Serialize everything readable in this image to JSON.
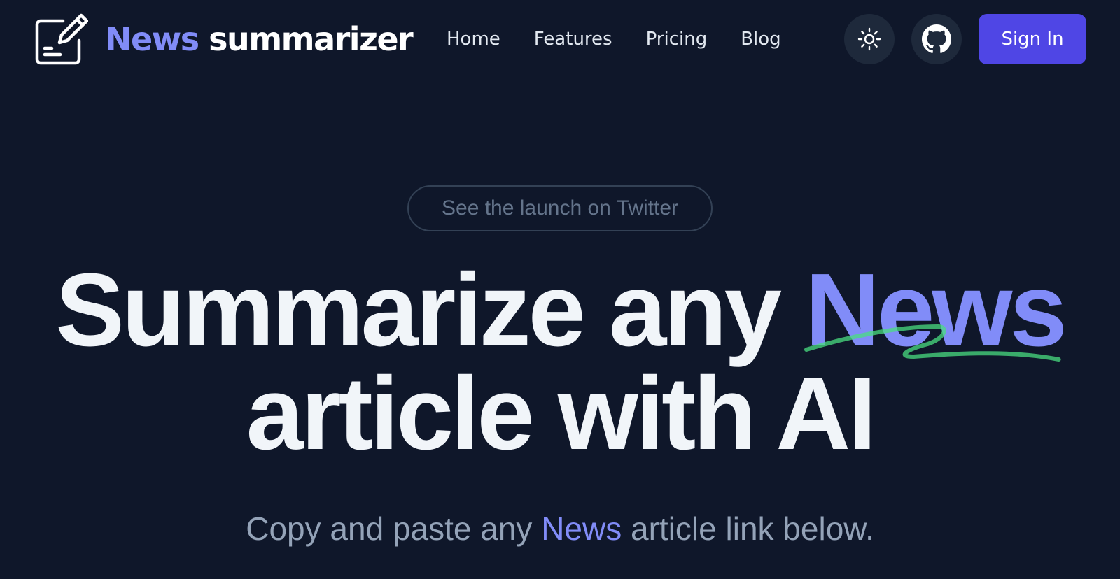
{
  "brand": {
    "name_accent": "News",
    "name_rest": "summarizer",
    "logo_icon": "note-pencil-icon",
    "accent_color": "#818cf8"
  },
  "nav": {
    "links": [
      {
        "label": "Home"
      },
      {
        "label": "Features"
      },
      {
        "label": "Pricing"
      },
      {
        "label": "Blog"
      }
    ],
    "theme_toggle_icon": "sun-icon",
    "github_icon": "github-icon",
    "sign_in_label": "Sign In",
    "sign_in_color": "#4f46e5"
  },
  "hero": {
    "announcement": "See the launch on Twitter",
    "headline_part1": "Summarize any",
    "headline_accent": "News",
    "headline_line2": "article with AI",
    "underline_color": "#4ade80",
    "subtext_before": "Copy and paste any",
    "subtext_accent": "News",
    "subtext_after": "article link below."
  },
  "colors": {
    "background": "#0f172a",
    "accent": "#818cf8",
    "muted_text": "#94a3b8"
  }
}
